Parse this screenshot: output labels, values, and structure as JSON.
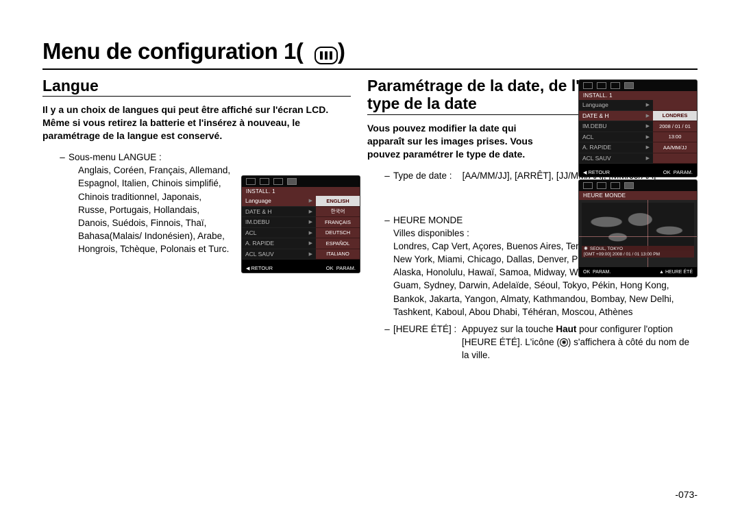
{
  "page": {
    "title": "Menu de configuration 1(",
    "title_end": ")",
    "number": "-073-"
  },
  "langue": {
    "heading": "Langue",
    "intro": "Il y a un choix de langues qui peut être affiché sur l'écran LCD. Même si vous retirez la batterie et l'insérez à nouveau, le paramétrage de la langue est conservé.",
    "list_lead": "Sous-menu LANGUE :",
    "list_body": "Anglais, Coréen, Français, Allemand, Espagnol, Italien, Chinois simplifié, Chinois traditionnel, Japonais, Russe, Portugais, Hollandais, Danois, Suédois, Finnois, Thaï, Bahasa(Malais/ Indonésien), Arabe, Hongrois, Tchèque, Polonais et Turc."
  },
  "date": {
    "heading": "Paramétrage de la date, de l'heure et du type de la date",
    "intro": "Vous pouvez modifier la date qui apparaît sur les images prises. Vous pouvez paramétrer le type de date.",
    "type_lead": "Type de date :",
    "type_vals": "[AA/MM/JJ], [ARRÊT], [JJ/MM/AA], [MM/JJ/AA]",
    "world_lead": "HEURE MONDE",
    "world_sub": "Villes disponibles :",
    "world_cities": "Londres, Cap Vert, Açores, Buenos Aires, Terre-neuve, Caracas, La Paz, New York, Miami, Chicago, Dallas, Denver, Phoenix, LA, San Francisco, Alaska, Honolulu, Hawaï, Samoa, Midway, Wellington, Auckland, Okhotsk, Guam, Sydney, Darwin, Adelaïde, Séoul, Tokyo, Pékin, Hong Kong, Bankok, Jakarta, Yangon, Almaty, Kathmandou, Bombay, New Delhi, Tashkent, Kaboul, Abou Dhabi, Téhéran, Moscou, Athènes",
    "dst_term": "[HEURE ÉTÉ] :",
    "dst_desc_1": "Appuyez sur la touche ",
    "dst_desc_haut": "Haut",
    "dst_desc_2": " pour configurer l'option [HEURE ÉTÉ]. L'icône (",
    "dst_desc_3": ") s'affichera à côté du nom de la ville."
  },
  "lcd": {
    "header": "INSTALL. 1",
    "hdr_world": "HEURE MONDE",
    "menu_left": [
      "Language",
      "DATE & H",
      "IM.DEBU",
      "ACL",
      "A. RAPIDE",
      "ACL SAUV"
    ],
    "lang_vals": [
      "ENGLISH",
      "한국어",
      "FRANÇAIS",
      "DEUTSCH",
      "ESPAÑOL",
      "ITALIANO"
    ],
    "date_vals": [
      "",
      "LONDRES",
      "2008 / 01 / 01",
      "13:00",
      "AA/MM/JJ",
      ""
    ],
    "footer_l_sym": "◀",
    "footer_l": "RETOUR",
    "footer_ok": "OK",
    "footer_r": "PARAM.",
    "world_city": "SEOUL, TOKYO",
    "world_info": "[GMT +09:00] 2008 / 01 / 01  13:00 PM",
    "world_footer_r_sym": "▲",
    "world_footer_r": "HEURE ÉTÉ"
  }
}
